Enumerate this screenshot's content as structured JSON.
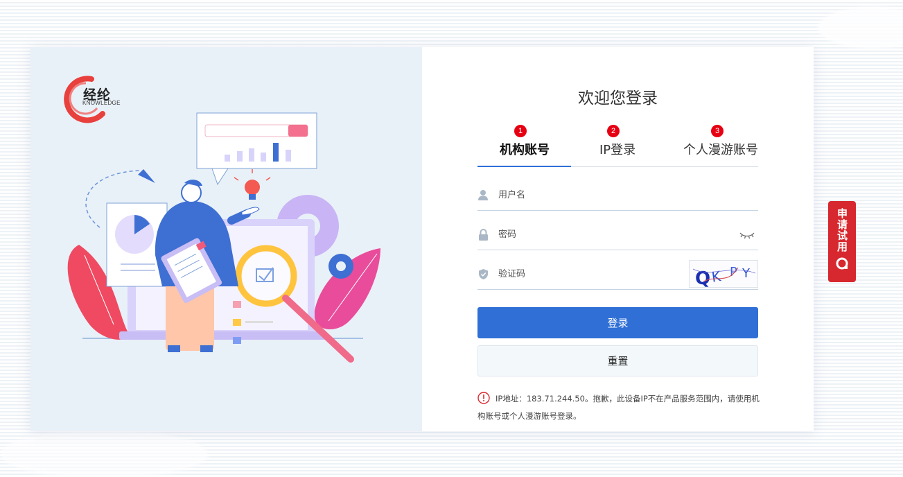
{
  "logo": {
    "name": "经纶",
    "subtitle": "KNOWLEDGE"
  },
  "welcome_title": "欢迎您登录",
  "tabs": [
    {
      "num": "1",
      "label": "机构账号",
      "active": true
    },
    {
      "num": "2",
      "label": "IP登录",
      "active": false
    },
    {
      "num": "3",
      "label": "个人漫游账号",
      "active": false
    }
  ],
  "form": {
    "username_placeholder": "用户名",
    "password_placeholder": "密码",
    "captcha_placeholder": "验证码",
    "captcha_image_text": "QKPY"
  },
  "buttons": {
    "login": "登录",
    "reset": "重置"
  },
  "notice": "IP地址：183.71.244.50。抱歉，此设备IP不在产品服务范围内，请使用机构账号或个人漫游账号登录。",
  "side_button": {
    "label": "申请试用"
  },
  "colors": {
    "primary": "#2f6fd6",
    "accent_red": "#d7282f",
    "badge_red": "#e60012"
  }
}
